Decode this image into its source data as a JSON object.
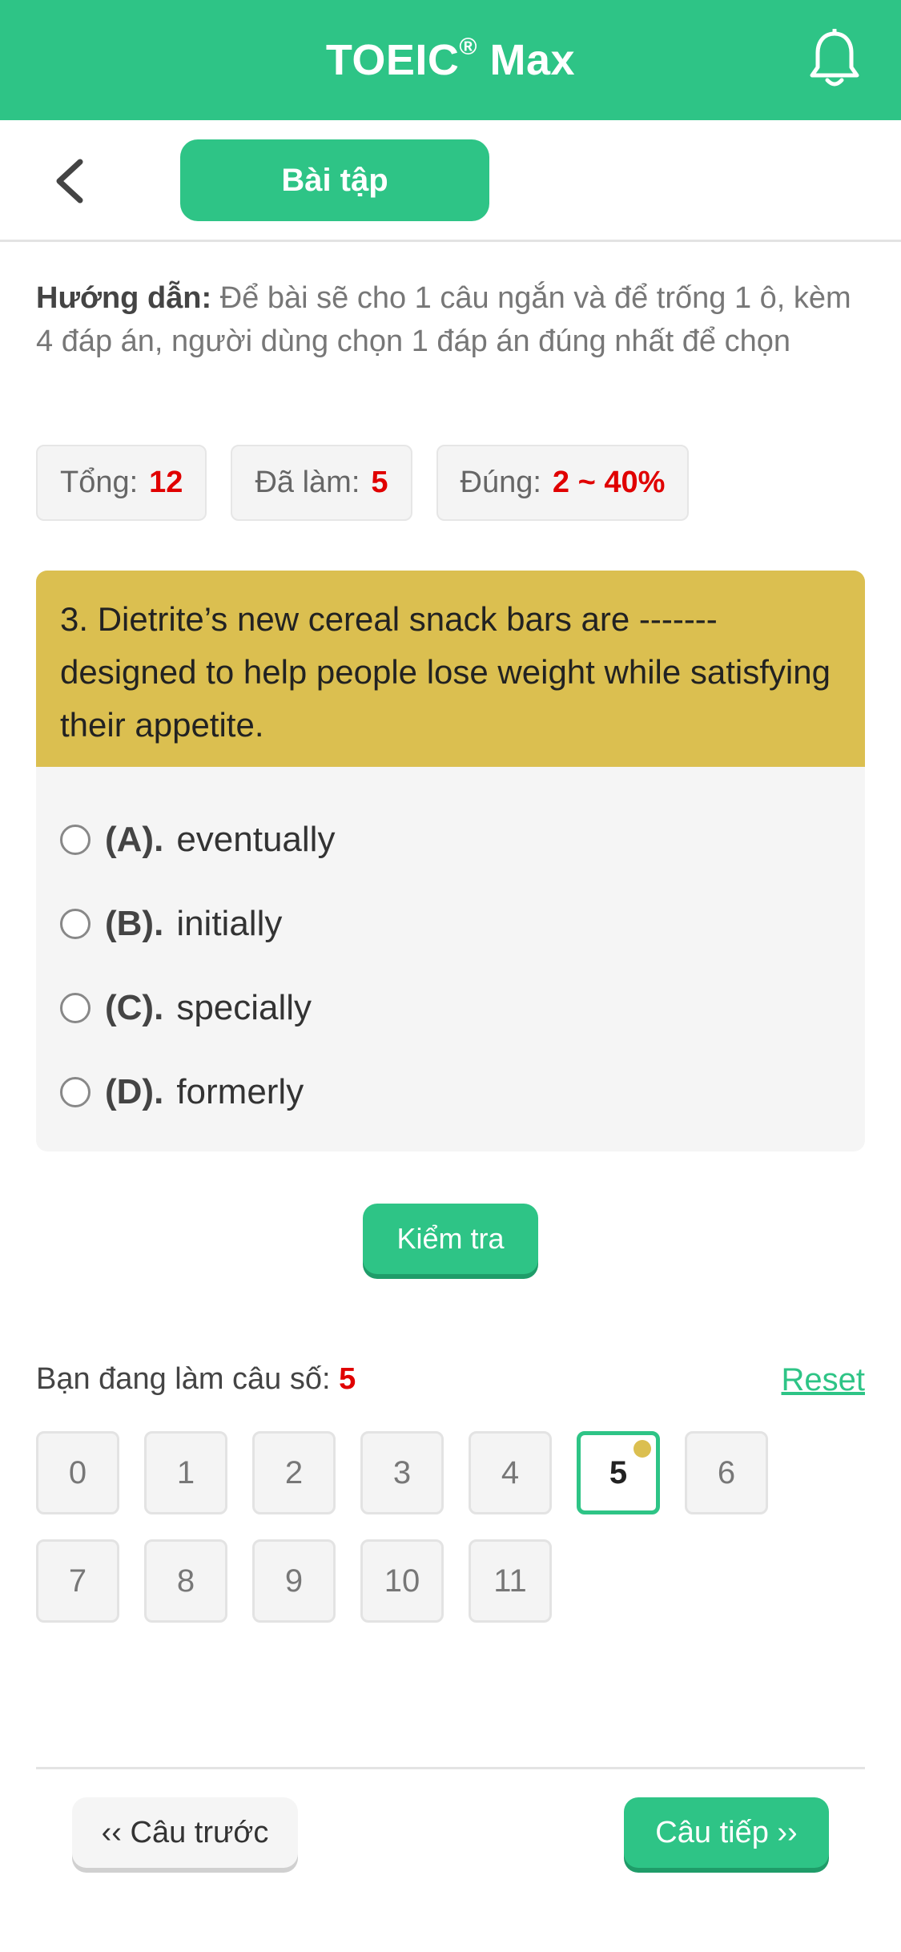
{
  "header": {
    "title": "TOEIC",
    "title_mark": "®",
    "title_suffix": " Max",
    "bell_icon": "bell-icon"
  },
  "subbar": {
    "back_icon": "chevron-left-icon",
    "tab_label": "Bài tập"
  },
  "instructions": {
    "label": "Hướng dẫn:",
    "text": " Để bài sẽ cho 1 câu ngắn và để trống 1 ô, kèm 4 đáp án, người dùng chọn 1 đáp án đúng nhất để chọn"
  },
  "stats": {
    "total_label": "Tổng:",
    "total_value": "12",
    "done_label": "Đã làm:",
    "done_value": "5",
    "correct_label": "Đúng:",
    "correct_value": "2 ~ 40%"
  },
  "question": {
    "text": "3. Dietrite’s new cereal snack bars are ------- designed to help people lose weight while satisfying their appetite.",
    "options": [
      {
        "letter": "(A).",
        "text": "eventually"
      },
      {
        "letter": "(B).",
        "text": "initially"
      },
      {
        "letter": "(C).",
        "text": "specially"
      },
      {
        "letter": "(D).",
        "text": "formerly"
      }
    ]
  },
  "check_button": "Kiểm tra",
  "progress": {
    "label": "Bạn đang làm câu số:",
    "current": "5",
    "reset": "Reset"
  },
  "question_numbers": [
    "0",
    "1",
    "2",
    "3",
    "4",
    "5",
    "6",
    "7",
    "8",
    "9",
    "10",
    "11"
  ],
  "active_index": 5,
  "nav": {
    "prev": "‹‹ Câu trước",
    "next": "Câu tiếp ››"
  },
  "colors": {
    "brand": "#2ec486",
    "question_bg": "#dbbf50",
    "highlight": "#e00000"
  }
}
